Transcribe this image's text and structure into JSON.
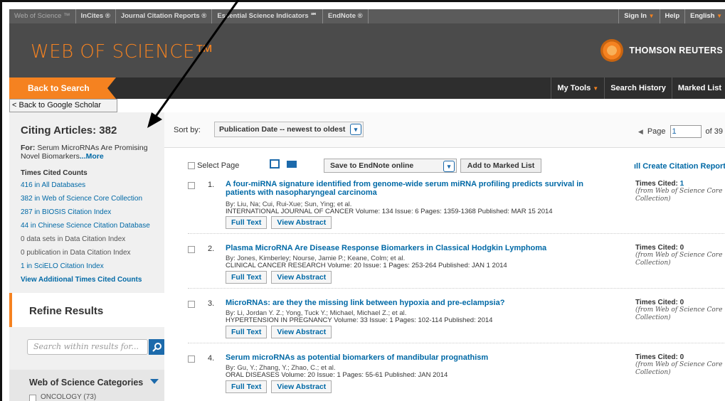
{
  "topbar": {
    "links": [
      "Web of Science ™",
      "InCites ®",
      "Journal Citation Reports ®",
      "Essential Science Indicators ℠",
      "EndNote ®"
    ],
    "right": [
      "Sign In",
      "Help",
      "English"
    ]
  },
  "header": {
    "logo": "WEB OF SCIENCE™",
    "brand": "THOMSON REUTERS"
  },
  "nav": {
    "back": "Back to Search",
    "right": [
      "My Tools",
      "Search History",
      "Marked List"
    ]
  },
  "google_scholar": "< Back to Google Scholar",
  "sidebar": {
    "citing": "Citing Articles: 382",
    "for_label": "For:",
    "for_text": "Serum MicroRNAs Are Promising Novel Biomarkers",
    "more": "...More",
    "times_cited_header": "Times Cited Counts",
    "counts": [
      "416 in All Databases",
      "382 in Web of Science Core Collection",
      "287 in BIOSIS Citation Index",
      "44 in Chinese Science Citation Database",
      "0 data sets in Data Citation Index",
      "0 publication in Data Citation Index",
      "1 in SciELO Citation Index",
      "View Additional Times Cited Counts"
    ],
    "refine": "Refine Results",
    "search_placeholder": "Search within results for...",
    "wos_categories": "Web of Science Categories",
    "oncology": "ONCOLOGY (73)"
  },
  "sort": {
    "label": "Sort by:",
    "value": "Publication Date -- newest to oldest",
    "page_label": "Page",
    "page": "1",
    "of": "of 39"
  },
  "toolbar": {
    "select_page": "Select Page",
    "save": "Save to EndNote online",
    "add": "Add to Marked List",
    "citation_report": "Create Citation Report"
  },
  "buttons": {
    "full_text": "Full Text",
    "abstract": "View Abstract"
  },
  "times_cited_label": "Times Cited:",
  "from_label": "(from Web of Science Core Collection)",
  "records": [
    {
      "num": "1.",
      "title": "A four-miRNA signature identified from genome-wide serum miRNA profiling predicts survival in patients with nasopharyngeal carcinoma",
      "by": "By: Liu, Na; Cui, Rui-Xue; Sun, Ying; et al.",
      "journal": "INTERNATIONAL JOURNAL OF CANCER  Volume: 134  Issue: 6  Pages: 1359-1368  Published: MAR 15 2014",
      "cited": "1"
    },
    {
      "num": "2.",
      "title": "Plasma MicroRNA Are Disease Response Biomarkers in Classical Hodgkin Lymphoma",
      "by": "By: Jones, Kimberley; Nourse, Jamie P.; Keane, Colm; et al.",
      "journal": "CLINICAL CANCER RESEARCH  Volume: 20  Issue: 1  Pages: 253-264  Published: JAN 1 2014",
      "cited": "0"
    },
    {
      "num": "3.",
      "title": "MicroRNAs: are they the missing link between hypoxia and pre-eclampsia?",
      "by": "By: Li, Jordan Y. Z.; Yong, Tuck Y.; Michael, Michael Z.; et al.",
      "journal": "HYPERTENSION IN PREGNANCY  Volume: 33  Issue: 1  Pages: 102-114  Published: 2014",
      "cited": "0"
    },
    {
      "num": "4.",
      "title": "Serum microRNAs as potential biomarkers of mandibular prognathism",
      "by": "By: Gu, Y.; Zhang, Y.; Zhao, C.; et al.",
      "journal": "ORAL DISEASES  Volume: 20  Issue: 1  Pages: 55-61  Published: JAN 2014",
      "cited": "0"
    }
  ],
  "colors": {
    "accent": "#f58220",
    "link": "#0069a6",
    "header": "#4b4b4b"
  }
}
